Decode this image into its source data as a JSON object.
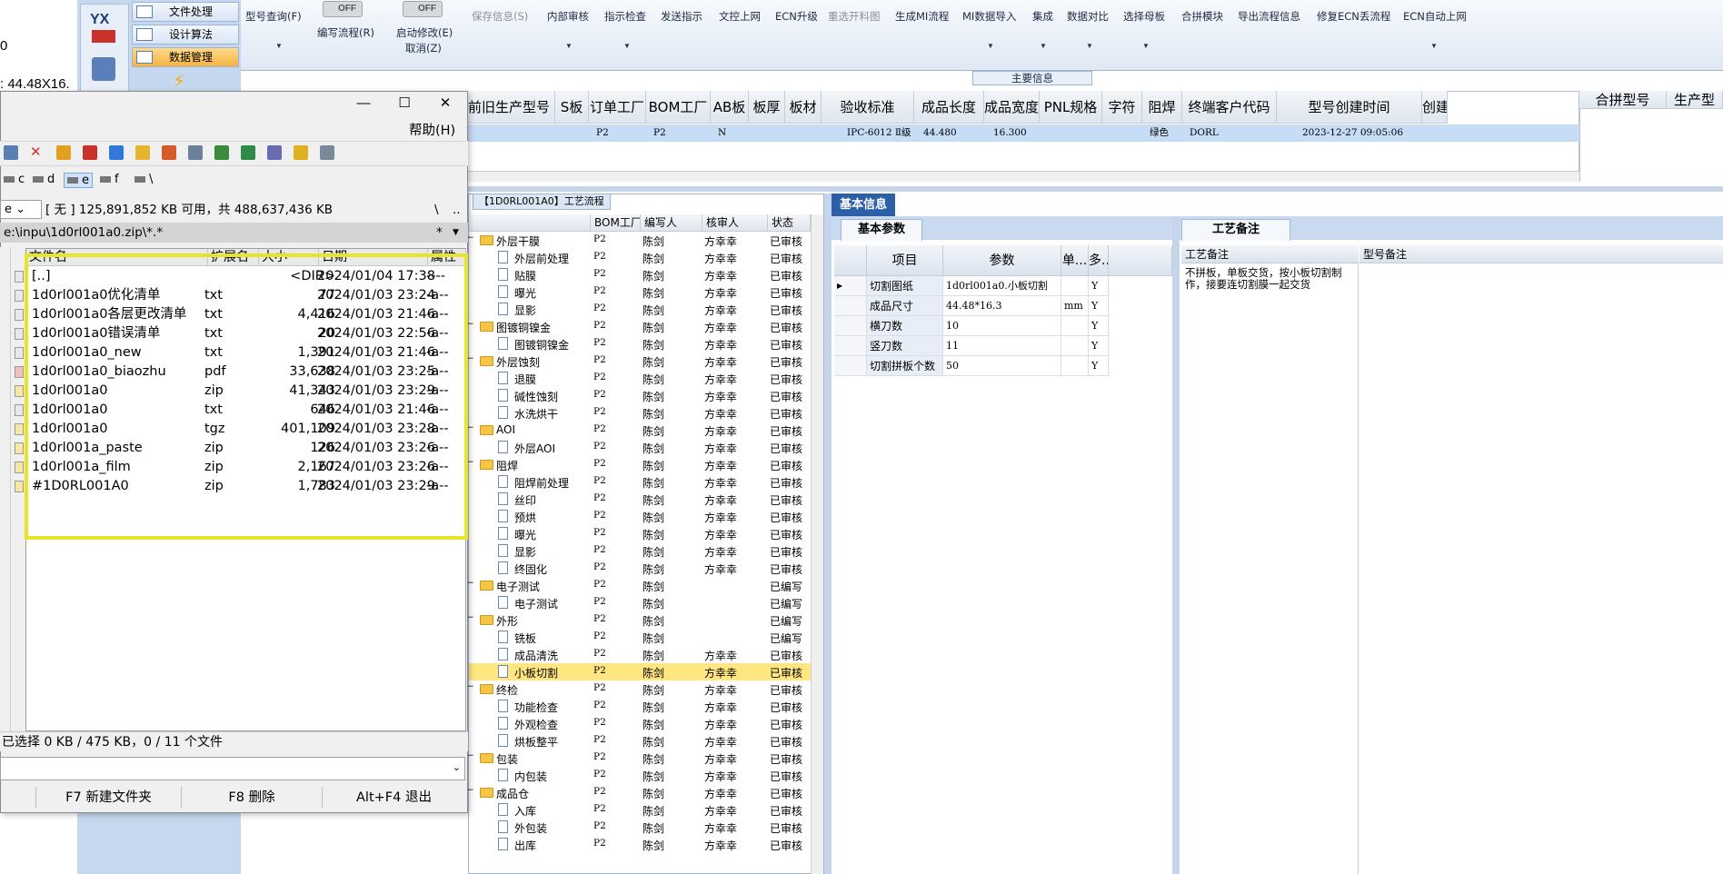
{
  "left_strip": {
    "line1": "0",
    "line2": ": 44.48X16."
  },
  "nav": {
    "logo_text": "YX",
    "items": [
      {
        "label": "文件处理"
      },
      {
        "label": "设计算法"
      },
      {
        "label": "数据管理"
      }
    ]
  },
  "ribbon": {
    "buttons": [
      {
        "label": "型号查询(F)"
      },
      {
        "label": "编写流程(R)"
      },
      {
        "label": "启动修改(E)"
      },
      {
        "label": "取消(Z)"
      },
      {
        "label": "保存信息(S)"
      },
      {
        "label": "内部审核"
      },
      {
        "label": "指示检查"
      },
      {
        "label": "发送指示"
      },
      {
        "label": "文控上网"
      },
      {
        "label": "ECN升级"
      },
      {
        "label": "重选开料图"
      },
      {
        "label": "生成MI流程"
      },
      {
        "label": "MI数据导入"
      },
      {
        "label": "集成"
      },
      {
        "label": "数据对比"
      },
      {
        "label": "选择母板"
      },
      {
        "label": "合拼模块"
      },
      {
        "label": "导出流程信息"
      },
      {
        "label": "修复ECN丢流程"
      },
      {
        "label": "ECN自动上网"
      }
    ],
    "toggle1": "OFF",
    "toggle2": "OFF",
    "main_info_label": "主要信息"
  },
  "top_table": {
    "headers": [
      "前旧生产型号",
      "S板",
      "订单工厂",
      "BOM工厂",
      "AB板",
      "板厚",
      "板材",
      "验收标准",
      "成品长度",
      "成品宽度",
      "PNL规格",
      "字符",
      "阻焊",
      "终端客户代码",
      "型号创建时间",
      "创建"
    ],
    "row": [
      "",
      "",
      "P2",
      "P2",
      "N",
      "",
      "",
      "IPC-6012 Ⅱ级",
      "44.480",
      "16.300",
      "",
      "",
      "绿色",
      "DORL",
      "2023-12-27 09:05:06",
      ""
    ],
    "right_headers": [
      "合拼型号",
      "生产型"
    ]
  },
  "tree": {
    "tab_label": "【1D0RL001A0】工艺流程",
    "headers": [
      "",
      "BOM工厂",
      "编写人",
      "核审人",
      "状态"
    ],
    "rows": [
      {
        "level": 1,
        "type": "folder",
        "name": "外层干膜",
        "bom": "P2",
        "writer": "陈剑",
        "reviewer": "方幸幸",
        "status": "已审核"
      },
      {
        "level": 2,
        "type": "doc",
        "name": "外层前处理",
        "bom": "P2",
        "writer": "陈剑",
        "reviewer": "方幸幸",
        "status": "已审核"
      },
      {
        "level": 2,
        "type": "doc",
        "name": "贴膜",
        "bom": "P2",
        "writer": "陈剑",
        "reviewer": "方幸幸",
        "status": "已审核"
      },
      {
        "level": 2,
        "type": "doc",
        "name": "曝光",
        "bom": "P2",
        "writer": "陈剑",
        "reviewer": "方幸幸",
        "status": "已审核"
      },
      {
        "level": 2,
        "type": "doc",
        "name": "显影",
        "bom": "P2",
        "writer": "陈剑",
        "reviewer": "方幸幸",
        "status": "已审核"
      },
      {
        "level": 1,
        "type": "folder",
        "name": "图镀铜镍金",
        "bom": "P2",
        "writer": "陈剑",
        "reviewer": "方幸幸",
        "status": "已审核"
      },
      {
        "level": 2,
        "type": "doc",
        "name": "图镀铜镍金",
        "bom": "P2",
        "writer": "陈剑",
        "reviewer": "方幸幸",
        "status": "已审核"
      },
      {
        "level": 1,
        "type": "folder",
        "name": "外层蚀刻",
        "bom": "P2",
        "writer": "陈剑",
        "reviewer": "方幸幸",
        "status": "已审核"
      },
      {
        "level": 2,
        "type": "doc",
        "name": "退膜",
        "bom": "P2",
        "writer": "陈剑",
        "reviewer": "方幸幸",
        "status": "已审核"
      },
      {
        "level": 2,
        "type": "doc",
        "name": "碱性蚀刻",
        "bom": "P2",
        "writer": "陈剑",
        "reviewer": "方幸幸",
        "status": "已审核"
      },
      {
        "level": 2,
        "type": "doc",
        "name": "水洗烘干",
        "bom": "P2",
        "writer": "陈剑",
        "reviewer": "方幸幸",
        "status": "已审核"
      },
      {
        "level": 1,
        "type": "folder",
        "name": "AOI",
        "bom": "P2",
        "writer": "陈剑",
        "reviewer": "方幸幸",
        "status": "已审核"
      },
      {
        "level": 2,
        "type": "doc",
        "name": "外层AOI",
        "bom": "P2",
        "writer": "陈剑",
        "reviewer": "方幸幸",
        "status": "已审核"
      },
      {
        "level": 1,
        "type": "folder",
        "name": "阻焊",
        "bom": "P2",
        "writer": "陈剑",
        "reviewer": "方幸幸",
        "status": "已审核"
      },
      {
        "level": 2,
        "type": "doc",
        "name": "阻焊前处理",
        "bom": "P2",
        "writer": "陈剑",
        "reviewer": "方幸幸",
        "status": "已审核"
      },
      {
        "level": 2,
        "type": "doc",
        "name": "丝印",
        "bom": "P2",
        "writer": "陈剑",
        "reviewer": "方幸幸",
        "status": "已审核"
      },
      {
        "level": 2,
        "type": "doc",
        "name": "预烘",
        "bom": "P2",
        "writer": "陈剑",
        "reviewer": "方幸幸",
        "status": "已审核"
      },
      {
        "level": 2,
        "type": "doc",
        "name": "曝光",
        "bom": "P2",
        "writer": "陈剑",
        "reviewer": "方幸幸",
        "status": "已审核"
      },
      {
        "level": 2,
        "type": "doc",
        "name": "显影",
        "bom": "P2",
        "writer": "陈剑",
        "reviewer": "方幸幸",
        "status": "已审核"
      },
      {
        "level": 2,
        "type": "doc",
        "name": "终固化",
        "bom": "P2",
        "writer": "陈剑",
        "reviewer": "方幸幸",
        "status": "已审核"
      },
      {
        "level": 1,
        "type": "folder",
        "name": "电子测试",
        "bom": "P2",
        "writer": "陈剑",
        "reviewer": "",
        "status": "已编写"
      },
      {
        "level": 2,
        "type": "doc",
        "name": "电子测试",
        "bom": "P2",
        "writer": "陈剑",
        "reviewer": "",
        "status": "已编写"
      },
      {
        "level": 1,
        "type": "folder",
        "name": "外形",
        "bom": "P2",
        "writer": "陈剑",
        "reviewer": "",
        "status": "已编写"
      },
      {
        "level": 2,
        "type": "doc",
        "name": "铣板",
        "bom": "P2",
        "writer": "陈剑",
        "reviewer": "",
        "status": "已编写"
      },
      {
        "level": 2,
        "type": "doc",
        "name": "成品清洗",
        "bom": "P2",
        "writer": "陈剑",
        "reviewer": "方幸幸",
        "status": "已审核"
      },
      {
        "level": 2,
        "type": "doc",
        "name": "小板切割",
        "bom": "P2",
        "writer": "陈剑",
        "reviewer": "方幸幸",
        "status": "已审核",
        "selected": true
      },
      {
        "level": 1,
        "type": "folder",
        "name": "终检",
        "bom": "P2",
        "writer": "陈剑",
        "reviewer": "方幸幸",
        "status": "已审核"
      },
      {
        "level": 2,
        "type": "doc",
        "name": "功能检查",
        "bom": "P2",
        "writer": "陈剑",
        "reviewer": "方幸幸",
        "status": "已审核"
      },
      {
        "level": 2,
        "type": "doc",
        "name": "外观检查",
        "bom": "P2",
        "writer": "陈剑",
        "reviewer": "方幸幸",
        "status": "已审核"
      },
      {
        "level": 2,
        "type": "doc",
        "name": "烘板整平",
        "bom": "P2",
        "writer": "陈剑",
        "reviewer": "方幸幸",
        "status": "已审核"
      },
      {
        "level": 1,
        "type": "folder",
        "name": "包装",
        "bom": "P2",
        "writer": "陈剑",
        "reviewer": "方幸幸",
        "status": "已审核"
      },
      {
        "level": 2,
        "type": "doc",
        "name": "内包装",
        "bom": "P2",
        "writer": "陈剑",
        "reviewer": "方幸幸",
        "status": "已审核"
      },
      {
        "level": 1,
        "type": "folder",
        "name": "成品仓",
        "bom": "P2",
        "writer": "陈剑",
        "reviewer": "方幸幸",
        "status": "已审核"
      },
      {
        "level": 2,
        "type": "doc",
        "name": "入库",
        "bom": "P2",
        "writer": "陈剑",
        "reviewer": "方幸幸",
        "status": "已审核"
      },
      {
        "level": 2,
        "type": "doc",
        "name": "外包装",
        "bom": "P2",
        "writer": "陈剑",
        "reviewer": "方幸幸",
        "status": "已审核"
      },
      {
        "level": 2,
        "type": "doc",
        "name": "出库",
        "bom": "P2",
        "writer": "陈剑",
        "reviewer": "方幸幸",
        "status": "已审核"
      }
    ]
  },
  "basic_info": {
    "tab_label": "基本信息",
    "sub_tab_params": "基本参数",
    "sub_tab_remarks": "工艺备注",
    "param_headers": [
      "项目",
      "参数",
      "单...",
      "多..."
    ],
    "params": [
      {
        "item": "切割图纸",
        "value": "1d0rl001a0.小板切割",
        "unit": "",
        "flag": "Y"
      },
      {
        "item": "成品尺寸",
        "value": "44.48*16.3",
        "unit": "mm",
        "flag": "Y"
      },
      {
        "item": "横刀数",
        "value": "10",
        "unit": "",
        "flag": "Y"
      },
      {
        "item": "竖刀数",
        "value": "11",
        "unit": "",
        "flag": "Y"
      },
      {
        "item": "切割拼板个数",
        "value": "50",
        "unit": "",
        "flag": "Y"
      }
    ],
    "remark_header": "工艺备注",
    "remark_text": "不拼板，单板交货，按小板切割制作，接要连切割膜一起交货",
    "type_remark_header": "型号备注"
  },
  "file_manager": {
    "menu_help": "帮助(H)",
    "drives": [
      "c",
      "d",
      "e",
      "f",
      "\\"
    ],
    "drive_selector": "e",
    "free_space": "[ 无 ]  125,891,852 KB 可用，共 488,637,436 KB",
    "path": "e:\\inpu\\1d0rl001a0.zip\\*.*",
    "headers": [
      "文件名",
      "扩展名",
      "大小",
      "日期",
      "属性"
    ],
    "files": [
      {
        "name": "[..]",
        "ext": "",
        "size": "<DIR>",
        "date": "2024/01/04 17:38",
        "attr": "----"
      },
      {
        "name": "1d0rl001a0优化清单",
        "ext": "txt",
        "size": "77",
        "date": "2024/01/03 23:24",
        "attr": "-a--"
      },
      {
        "name": "1d0rl001a0各层更改清单",
        "ext": "txt",
        "size": "4,416",
        "date": "2024/01/03 21:46",
        "attr": "-a--"
      },
      {
        "name": "1d0rl001a0错误清单",
        "ext": "txt",
        "size": "20",
        "date": "2024/01/03 22:56",
        "attr": "-a--"
      },
      {
        "name": "1d0rl001a0_new",
        "ext": "txt",
        "size": "1,391",
        "date": "2024/01/03 21:46",
        "attr": "-a--"
      },
      {
        "name": "1d0rl001a0_biaozhu",
        "ext": "pdf",
        "size": "33,638",
        "date": "2024/01/03 23:25",
        "attr": "-a--"
      },
      {
        "name": "1d0rl001a0",
        "ext": "zip",
        "size": "41,343",
        "date": "2024/01/03 23:29",
        "attr": "-a--"
      },
      {
        "name": "1d0rl001a0",
        "ext": "txt",
        "size": "646",
        "date": "2024/01/03 21:46",
        "attr": "-a--"
      },
      {
        "name": "1d0rl001a0",
        "ext": "tgz",
        "size": "401,109",
        "date": "2024/01/03 23:28",
        "attr": "-a--"
      },
      {
        "name": "1d0rl001a_paste",
        "ext": "zip",
        "size": "126",
        "date": "2024/01/03 23:26",
        "attr": "-a--"
      },
      {
        "name": "1d0rl001a_film",
        "ext": "zip",
        "size": "2,167",
        "date": "2024/01/03 23:26",
        "attr": "-a--"
      },
      {
        "name": "#1D0RL001A0",
        "ext": "zip",
        "size": "1,783",
        "date": "2024/01/03 23:29",
        "attr": "-a--"
      }
    ],
    "status": "已选择 0 KB / 475 KB，0 / 11 个文件",
    "fkeys": [
      "F7 新建文件夹",
      "F8 删除",
      "Alt+F4 退出"
    ],
    "highlight_color": "#e8e42a"
  }
}
